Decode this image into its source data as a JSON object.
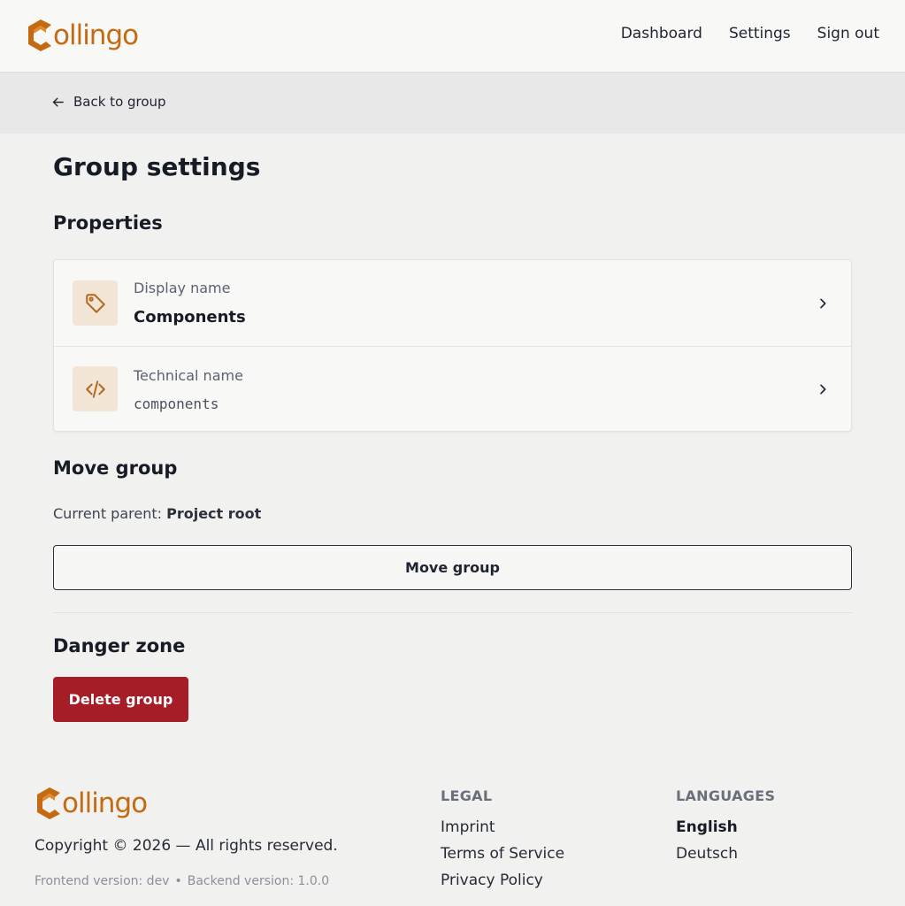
{
  "brand": {
    "name": "ollingo",
    "color": "#c46a12"
  },
  "nav": {
    "items": [
      "Dashboard",
      "Settings",
      "Sign out"
    ]
  },
  "subbar": {
    "back_label": "Back to group"
  },
  "page": {
    "title": "Group settings",
    "properties_title": "Properties",
    "properties": [
      {
        "icon": "tag-icon",
        "label": "Display name",
        "value": "Components"
      },
      {
        "icon": "code-icon",
        "label": "Technical name",
        "value": "components"
      }
    ],
    "move": {
      "title": "Move group",
      "parent_prefix": "Current parent:",
      "parent_value": "Project root",
      "button_label": "Move group"
    },
    "danger": {
      "title": "Danger zone",
      "delete_label": "Delete group",
      "color": "#a71d27"
    }
  },
  "footer": {
    "copyright": "Copyright © 2026 — All rights reserved.",
    "frontend_version": "Frontend version: dev",
    "separator": "•",
    "backend_version": "Backend version: 1.0.0",
    "legal": {
      "title": "LEGAL",
      "links": [
        "Imprint",
        "Terms of Service",
        "Privacy Policy"
      ]
    },
    "languages": {
      "title": "LANGUAGES",
      "items": [
        "English",
        "Deutsch"
      ],
      "active": "English"
    }
  }
}
